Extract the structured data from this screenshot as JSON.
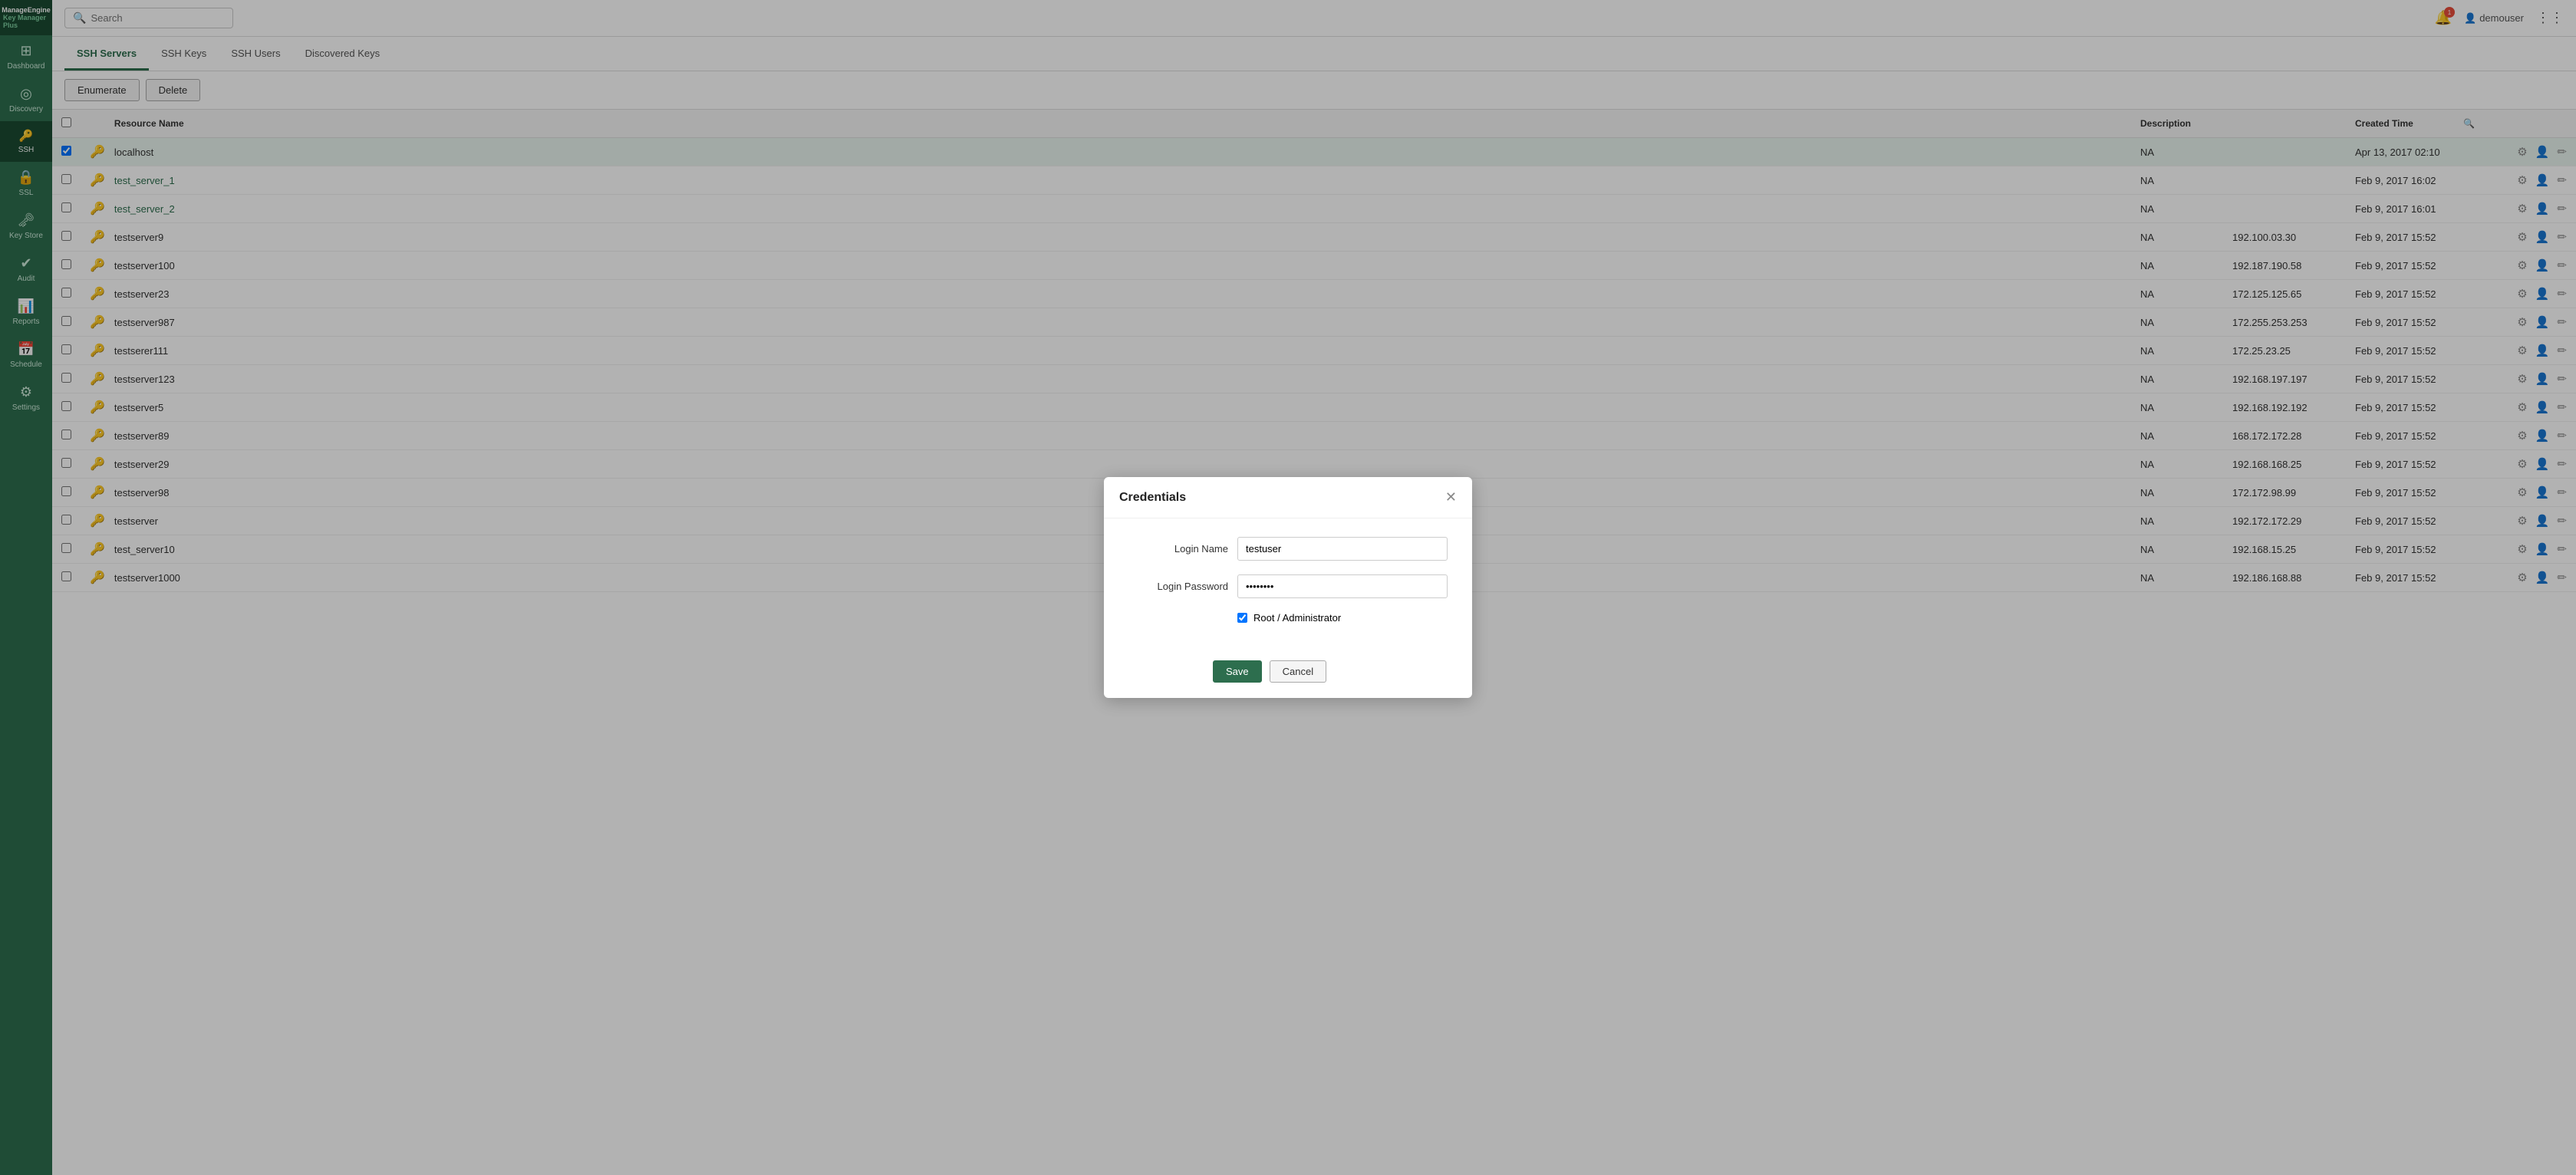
{
  "app": {
    "brand": "ManageEngine",
    "product": "Key Manager Plus"
  },
  "sidebar": {
    "items": [
      {
        "id": "dashboard",
        "label": "Dashboard",
        "icon": "⊞",
        "active": false
      },
      {
        "id": "discovery",
        "label": "Discovery",
        "icon": "◎",
        "active": false
      },
      {
        "id": "ssh",
        "label": "SSH",
        "icon": "⬛",
        "active": true
      },
      {
        "id": "ssl",
        "label": "SSL",
        "icon": "🔒",
        "active": false
      },
      {
        "id": "keystore",
        "label": "Key Store",
        "icon": "🗝",
        "active": false
      },
      {
        "id": "audit",
        "label": "Audit",
        "icon": "✔",
        "active": false
      },
      {
        "id": "reports",
        "label": "Reports",
        "icon": "📊",
        "active": false
      },
      {
        "id": "schedule",
        "label": "Schedule",
        "icon": "📅",
        "active": false
      },
      {
        "id": "settings",
        "label": "Settings",
        "icon": "⚙",
        "active": false
      }
    ]
  },
  "topbar": {
    "search_placeholder": "Search",
    "notifications_count": "1",
    "user": "demouser"
  },
  "tabs": [
    {
      "id": "ssh-servers",
      "label": "SSH Servers",
      "active": true
    },
    {
      "id": "ssh-keys",
      "label": "SSH Keys",
      "active": false
    },
    {
      "id": "ssh-users",
      "label": "SSH Users",
      "active": false
    },
    {
      "id": "discovered-keys",
      "label": "Discovered Keys",
      "active": false
    }
  ],
  "toolbar": {
    "enumerate_label": "Enumerate",
    "delete_label": "Delete"
  },
  "table": {
    "columns": [
      {
        "id": "checkbox",
        "label": ""
      },
      {
        "id": "icon",
        "label": ""
      },
      {
        "id": "resource",
        "label": "Resource Name"
      },
      {
        "id": "description",
        "label": "Description"
      },
      {
        "id": "ip",
        "label": ""
      },
      {
        "id": "time",
        "label": "Created Time"
      },
      {
        "id": "actions",
        "label": ""
      }
    ],
    "rows": [
      {
        "id": 1,
        "resource": "localhost",
        "description": "NA",
        "ip": "",
        "time": "Apr 13, 2017 02:10",
        "selected": true,
        "link": false
      },
      {
        "id": 2,
        "resource": "test_server_1",
        "description": "NA",
        "ip": "",
        "time": "Feb 9, 2017 16:02",
        "selected": false,
        "link": true
      },
      {
        "id": 3,
        "resource": "test_server_2",
        "description": "NA",
        "ip": "",
        "time": "Feb 9, 2017 16:01",
        "selected": false,
        "link": true
      },
      {
        "id": 4,
        "resource": "testserver9",
        "description": "NA",
        "ip": "192.100.03.30",
        "time": "Feb 9, 2017 15:52",
        "selected": false,
        "link": false
      },
      {
        "id": 5,
        "resource": "testserver100",
        "description": "NA",
        "ip": "192.187.190.58",
        "time": "Feb 9, 2017 15:52",
        "selected": false,
        "link": false
      },
      {
        "id": 6,
        "resource": "testserver23",
        "description": "NA",
        "ip": "172.125.125.65",
        "time": "Feb 9, 2017 15:52",
        "selected": false,
        "link": false
      },
      {
        "id": 7,
        "resource": "testserver987",
        "description": "NA",
        "ip": "172.255.253.253",
        "time": "Feb 9, 2017 15:52",
        "selected": false,
        "link": false
      },
      {
        "id": 8,
        "resource": "testserer111",
        "description": "NA",
        "ip": "172.25.23.25",
        "time": "Feb 9, 2017 15:52",
        "selected": false,
        "link": false
      },
      {
        "id": 9,
        "resource": "testserver123",
        "description": "NA",
        "ip": "192.168.197.197",
        "time": "Feb 9, 2017 15:52",
        "selected": false,
        "link": false
      },
      {
        "id": 10,
        "resource": "testserver5",
        "description": "NA",
        "ip": "192.168.192.192",
        "time": "Feb 9, 2017 15:52",
        "selected": false,
        "link": false
      },
      {
        "id": 11,
        "resource": "testserver89",
        "description": "NA",
        "ip": "168.172.172.28",
        "time": "Feb 9, 2017 15:52",
        "selected": false,
        "link": false
      },
      {
        "id": 12,
        "resource": "testserver29",
        "description": "NA",
        "ip": "192.168.168.25",
        "time": "Feb 9, 2017 15:52",
        "selected": false,
        "link": false
      },
      {
        "id": 13,
        "resource": "testserver98",
        "description": "NA",
        "ip": "172.172.98.99",
        "time": "Feb 9, 2017 15:52",
        "selected": false,
        "link": false
      },
      {
        "id": 14,
        "resource": "testserver",
        "description": "NA",
        "ip": "192.172.172.29",
        "time": "Feb 9, 2017 15:52",
        "selected": false,
        "link": false
      },
      {
        "id": 15,
        "resource": "test_server10",
        "description": "NA",
        "ip": "192.168.15.25",
        "time": "Feb 9, 2017 15:52",
        "selected": false,
        "link": false
      },
      {
        "id": 16,
        "resource": "testserver1000",
        "description": "NA",
        "ip": "192.186.168.88",
        "time": "Feb 9, 2017 15:52",
        "selected": false,
        "link": false
      }
    ]
  },
  "modal": {
    "title": "Credentials",
    "login_name_label": "Login Name",
    "login_name_value": "testuser",
    "login_password_label": "Login Password",
    "login_password_value": "••••••",
    "root_admin_label": "Root / Administrator",
    "root_admin_checked": true,
    "save_label": "Save",
    "cancel_label": "Cancel"
  }
}
